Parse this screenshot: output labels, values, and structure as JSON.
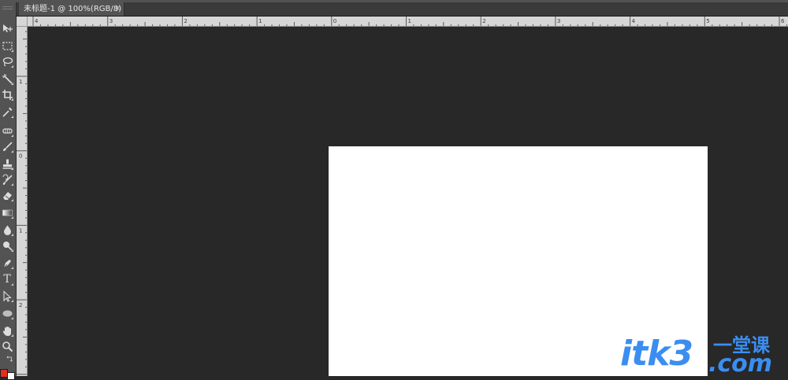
{
  "document": {
    "tab_title": "未标题-1 @ 100%(RGB/8)",
    "close_glyph": "×"
  },
  "toolbox": {
    "tools": [
      {
        "icon": "move-tool-icon"
      },
      {
        "icon": "marquee-tool-icon"
      },
      {
        "icon": "lasso-tool-icon"
      },
      {
        "icon": "magic-wand-tool-icon"
      },
      {
        "icon": "crop-tool-icon"
      },
      {
        "icon": "eyedropper-tool-icon"
      },
      {
        "icon": "spot-healing-tool-icon"
      },
      {
        "icon": "brush-tool-icon"
      },
      {
        "icon": "clone-stamp-tool-icon"
      },
      {
        "icon": "history-brush-tool-icon"
      },
      {
        "icon": "eraser-tool-icon"
      },
      {
        "icon": "gradient-tool-icon"
      },
      {
        "icon": "blur-tool-icon"
      },
      {
        "icon": "dodge-tool-icon"
      },
      {
        "icon": "pen-tool-icon"
      },
      {
        "icon": "type-tool-icon"
      },
      {
        "icon": "path-selection-tool-icon"
      },
      {
        "icon": "ellipse-tool-icon"
      },
      {
        "icon": "hand-tool-icon"
      },
      {
        "icon": "zoom-tool-icon"
      }
    ],
    "foreground_color": "#e0301e",
    "background_color": "#ffffff",
    "type_glyph": "T"
  },
  "rulers": {
    "horizontal_labels": [
      "4",
      "3",
      "2",
      "1",
      "0",
      "1",
      "2",
      "3",
      "4",
      "5",
      "6"
    ],
    "vertical_labels": [
      "1",
      "0",
      "1",
      "2",
      "3"
    ]
  },
  "colors": {
    "workspace": "#282828",
    "ui_panel": "#535353",
    "ruler": "#d6d6d6",
    "artboard": "#ffffff",
    "watermark": "#3b8ef0"
  },
  "watermark": {
    "main": "itk3",
    "sub": "一堂课",
    "dotcom": ".com"
  }
}
